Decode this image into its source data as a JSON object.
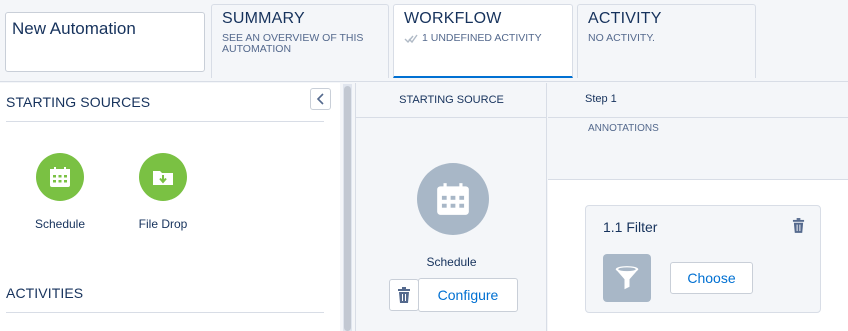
{
  "automation": {
    "name": "New Automation"
  },
  "tabs": [
    {
      "title": "SUMMARY",
      "subtitle": "SEE AN OVERVIEW OF THIS AUTOMATION"
    },
    {
      "title": "WORKFLOW",
      "subtitle": "1 UNDEFINED ACTIVITY",
      "icon": "double-check-icon"
    },
    {
      "title": "ACTIVITY",
      "subtitle": "NO ACTIVITY."
    }
  ],
  "left_panel": {
    "starting_sources_title": "STARTING SOURCES",
    "sources": [
      {
        "label": "Schedule",
        "icon": "calendar-icon"
      },
      {
        "label": "File Drop",
        "icon": "folder-download-icon"
      }
    ],
    "activities_title": "ACTIVITIES"
  },
  "canvas": {
    "starting_source_header": "STARTING SOURCE",
    "starting_source_label": "Schedule",
    "configure_label": "Configure",
    "step_header": "Step 1",
    "annotations_label": "ANNOTATIONS",
    "activity_card": {
      "title": "1.1 Filter",
      "icon": "funnel-icon",
      "choose_label": "Choose"
    }
  },
  "colors": {
    "accent": "#0070d2",
    "source_green": "#7ac143",
    "activity_gray": "#a8b7c7",
    "text": "#16325c"
  }
}
